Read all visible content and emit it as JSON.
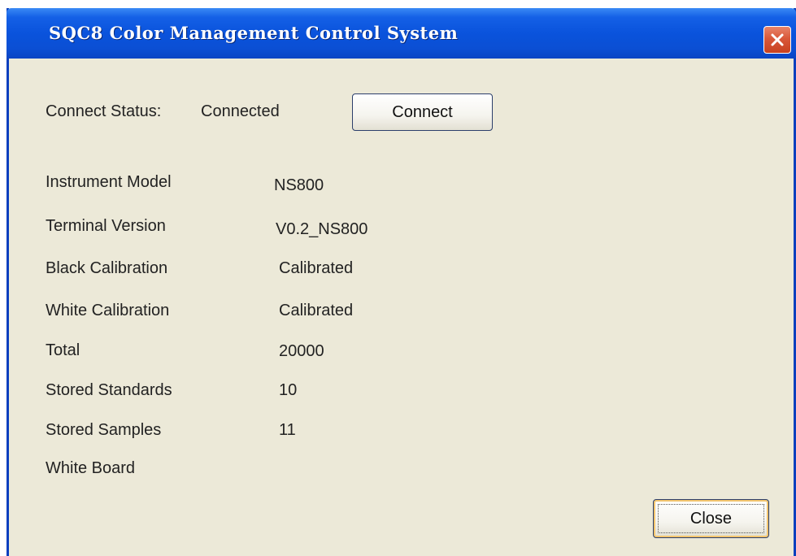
{
  "window": {
    "title": "SQC8 Color Management Control System",
    "close_icon": "close-icon",
    "titlebar_color": "#0a53dc",
    "body_color": "#ece9d8"
  },
  "connection": {
    "status_label": "Connect Status:",
    "status_value": "Connected",
    "connect_button": "Connect"
  },
  "info": {
    "instrument_model": {
      "label": "Instrument Model",
      "value": "NS800"
    },
    "terminal_version": {
      "label": "Terminal Version",
      "value": "V0.2_NS800"
    },
    "black_calibration": {
      "label": "Black Calibration",
      "value": "Calibrated"
    },
    "white_calibration": {
      "label": "White Calibration",
      "value": "Calibrated"
    },
    "total": {
      "label": "Total",
      "value": "20000"
    },
    "stored_standards": {
      "label": "Stored Standards",
      "value": "10"
    },
    "stored_samples": {
      "label": "Stored Samples",
      "value": "11"
    },
    "white_board": {
      "label": "White Board",
      "value": ""
    }
  },
  "footer": {
    "close_button": "Close"
  }
}
